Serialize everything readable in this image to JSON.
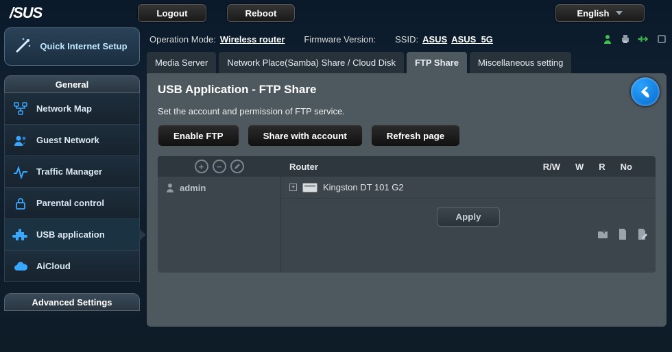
{
  "top": {
    "logo": "/SUS",
    "logout": "Logout",
    "reboot": "Reboot",
    "language": "English"
  },
  "info": {
    "op_mode_label": "Operation Mode:",
    "op_mode_value": "Wireless  router",
    "fw_label": "Firmware Version:",
    "ssid_label": "SSID:",
    "ssid_24": "ASUS",
    "ssid_5": "ASUS_5G"
  },
  "sidebar": {
    "qis": "Quick Internet Setup",
    "general_label": "General",
    "items": [
      {
        "label": "Network Map"
      },
      {
        "label": "Guest Network"
      },
      {
        "label": "Traffic Manager"
      },
      {
        "label": "Parental control"
      },
      {
        "label": "USB application"
      },
      {
        "label": "AiCloud"
      }
    ],
    "advanced_label": "Advanced Settings"
  },
  "tabs": [
    {
      "label": "Media Server"
    },
    {
      "label": "Network Place(Samba) Share / Cloud Disk"
    },
    {
      "label": "FTP Share"
    },
    {
      "label": "Miscellaneous setting"
    }
  ],
  "page": {
    "title": "USB Application - FTP Share",
    "desc": "Set the account and permission of FTP service.",
    "enable_ftp": "Enable FTP",
    "share_account": "Share with account",
    "refresh": "Refresh page",
    "user": "admin",
    "router_label": "Router",
    "perm_rw": "R/W",
    "perm_w": "W",
    "perm_r": "R",
    "perm_no": "No",
    "device": "Kingston DT 101 G2",
    "apply": "Apply"
  }
}
